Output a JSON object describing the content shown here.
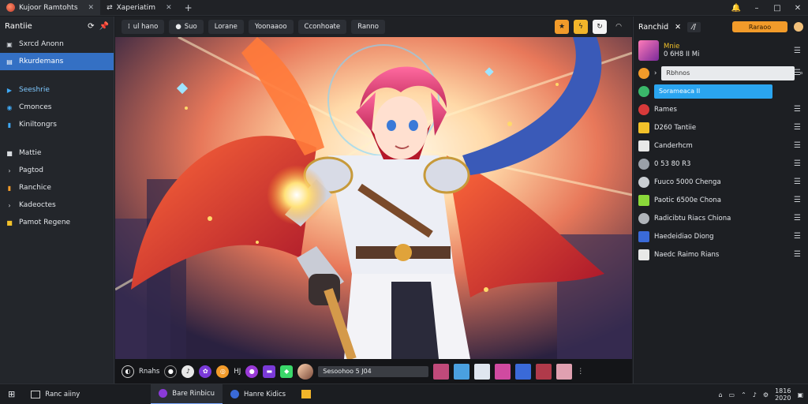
{
  "titlebar": {
    "tabs": [
      {
        "label": "Kujoor Ramtohts"
      },
      {
        "label": "Xaperiatim"
      }
    ],
    "new_tab": "+",
    "window_controls": [
      "–",
      "□",
      "✕"
    ]
  },
  "sidebar": {
    "title": "Rantiie",
    "items": [
      {
        "label": "Sxrcd Anonn",
        "icon": "folder-icon"
      },
      {
        "label": "Rkurdemans",
        "icon": "drive-icon",
        "selected": true
      },
      {
        "label": "Seeshrie",
        "icon": "play-icon"
      },
      {
        "label": "Cmonces",
        "icon": "camera-icon"
      },
      {
        "label": "Kiniltongrs",
        "icon": "phone-icon"
      },
      {
        "label": "Mattie",
        "icon": "square-icon"
      },
      {
        "label": "Pagtod",
        "icon": "music-icon"
      },
      {
        "label": "Ranchice",
        "icon": "bookmark-icon"
      },
      {
        "label": "Kadeoctes",
        "icon": "film-icon"
      },
      {
        "label": "Pamot Regene",
        "icon": "folder-icon"
      }
    ]
  },
  "toolbar": {
    "buttons": [
      "ul hano",
      "Suo",
      "Lorane",
      "Yoonaaoo",
      "Cconhoate",
      "Ranno"
    ]
  },
  "mediabar": {
    "play_label": "Rnahs",
    "count": "HJ",
    "progress_text": "Sesoohoo 5 J04"
  },
  "rpanel": {
    "title": "Ranchid",
    "header_btn": "Raraoo",
    "profile": {
      "name": "Mnie",
      "sub": "0 6H8 II Mi"
    },
    "search": "Rbhnos",
    "active": "Sorameaca Il",
    "rows": [
      {
        "label": "Rames"
      },
      {
        "label": "D260 Tantiie"
      },
      {
        "label": "Canderhcm"
      },
      {
        "label": "0 53 80 R3"
      },
      {
        "label": "Fuuco 5000 Chenga"
      },
      {
        "label": "Paotic 6500e Chona"
      },
      {
        "label": "Radicibtu Riacs Chiona"
      },
      {
        "label": "Haedeidiao Diong"
      },
      {
        "label": "Naedc Raimo Rians"
      }
    ]
  },
  "taskbar": {
    "items": [
      "Ranc aiiny",
      "Bare Rinbicu",
      "Hanre Kidics"
    ],
    "clock": "1816",
    "date": "2020"
  },
  "colors": {
    "accent": "#3470c4",
    "orange": "#f29b2a",
    "active_blue": "#2aa5f0"
  }
}
